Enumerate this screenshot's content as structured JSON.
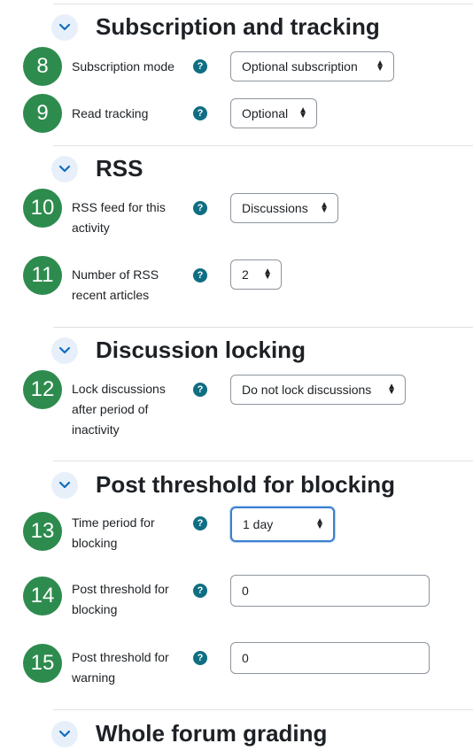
{
  "sections": {
    "subscription": {
      "title": "Subscription and tracking"
    },
    "rss": {
      "title": "RSS"
    },
    "locking": {
      "title": "Discussion locking"
    },
    "blocking": {
      "title": "Post threshold for blocking"
    },
    "grading": {
      "title": "Whole forum grading"
    }
  },
  "fields": {
    "subscription_mode": {
      "step": "8",
      "label": "Subscription mode",
      "value": "Optional subscription"
    },
    "read_tracking": {
      "step": "9",
      "label": "Read tracking",
      "value": "Optional"
    },
    "rss_feed": {
      "step": "10",
      "label": "RSS feed for this activity",
      "value": "Discussions"
    },
    "rss_articles": {
      "step": "11",
      "label": "Number of RSS recent articles",
      "value": "2"
    },
    "lock_discussions": {
      "step": "12",
      "label": "Lock discussions after period of inactivity",
      "value": "Do not lock discussions"
    },
    "time_period": {
      "step": "13",
      "label": "Time period for blocking",
      "value": "1 day"
    },
    "post_threshold_blocking": {
      "step": "14",
      "label": "Post threshold for blocking",
      "value": "0"
    },
    "post_threshold_warning": {
      "step": "15",
      "label": "Post threshold for warning",
      "value": "0"
    }
  },
  "help_glyph": "?",
  "icons": {
    "expand": "chevron-down-icon",
    "help": "help-circle-icon",
    "select": "select-caret-icon"
  },
  "colors": {
    "badge": "#2e8b4e",
    "help": "#0f6e82",
    "chevron_bg": "#e7f0fa",
    "chevron": "#0f6cbf",
    "focus": "#3b7fd1"
  }
}
